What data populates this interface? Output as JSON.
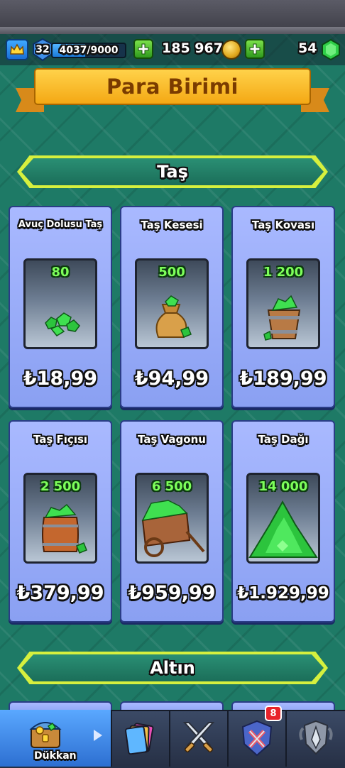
{
  "header": {
    "level": "32",
    "xp_text": "4037/9000",
    "xp_progress": 0.449,
    "gold": "185 967",
    "gems": "54"
  },
  "page": {
    "title": "Para Birimi"
  },
  "sections": {
    "gems_title": "Taş",
    "gold_title": "Altın"
  },
  "offers": [
    {
      "name": "Avuç Dolusu Taş",
      "amount": "80",
      "price": "₺18,99"
    },
    {
      "name": "Taş Kesesi",
      "amount": "500",
      "price": "₺94,99"
    },
    {
      "name": "Taş Kovası",
      "amount": "1 200",
      "price": "₺189,99"
    },
    {
      "name": "Taş Fıçısı",
      "amount": "2 500",
      "price": "₺379,99"
    },
    {
      "name": "Taş Vagonu",
      "amount": "6 500",
      "price": "₺959,99"
    },
    {
      "name": "Taş Dağı",
      "amount": "14 000",
      "price": "₺1.929,99"
    }
  ],
  "nav": {
    "shop_label": "Dükkan",
    "clan_badge": "8",
    "tabs": [
      "shop-icon",
      "cards-icon",
      "battle-icon",
      "clan-icon",
      "events-icon"
    ]
  },
  "colors": {
    "background": "#1e7a66",
    "card": "#9db0fb",
    "gem_green": "#39d64a",
    "title_banner": "#f8b81e"
  }
}
